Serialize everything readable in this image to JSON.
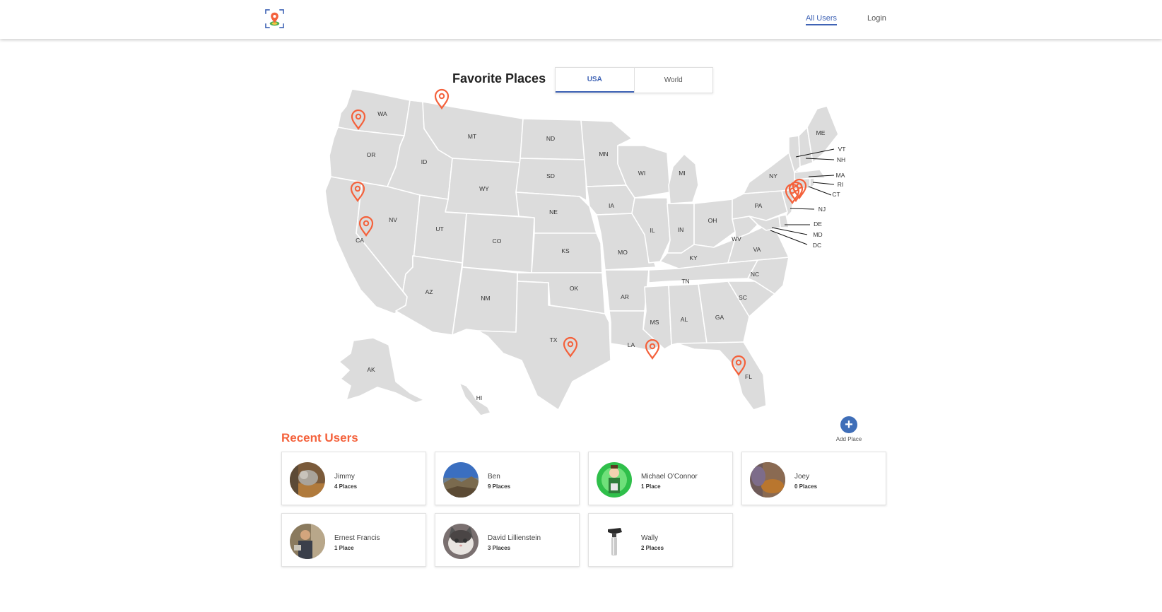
{
  "header": {
    "logo_icon": "map-pin-logo",
    "nav": [
      {
        "label": "All Users",
        "active": true
      },
      {
        "label": "Login",
        "active": false
      }
    ],
    "accent_color": "#3f63b5"
  },
  "main": {
    "title": "Favorite Places",
    "tabs": [
      {
        "label": "USA",
        "active": true
      },
      {
        "label": "World",
        "active": false
      }
    ],
    "map": {
      "region": "USA",
      "pin_color": "#f4613b",
      "state_labels": [
        "WA",
        "OR",
        "CA",
        "ID",
        "NV",
        "MT",
        "WY",
        "UT",
        "AZ",
        "CO",
        "NM",
        "ND",
        "SD",
        "NE",
        "KS",
        "OK",
        "TX",
        "MN",
        "IA",
        "MO",
        "AR",
        "LA",
        "WI",
        "IL",
        "MI",
        "IN",
        "OH",
        "KY",
        "TN",
        "MS",
        "AL",
        "GA",
        "FL",
        "SC",
        "NC",
        "VA",
        "WV",
        "PA",
        "NY",
        "ME",
        "VT",
        "NH",
        "MA",
        "RI",
        "CT",
        "NJ",
        "DE",
        "MD",
        "DC",
        "AK",
        "HI"
      ],
      "pins": [
        "WA",
        "MT",
        "CA",
        "CA",
        "TX",
        "LA",
        "FL",
        "NY",
        "NJ",
        "CT"
      ]
    },
    "add_place": {
      "icon": "plus-icon",
      "label": "Add Place"
    }
  },
  "recent_users": {
    "title": "Recent Users",
    "title_color": "#f4613b",
    "users": [
      {
        "name": "Jimmy",
        "places": "4 Places",
        "avatar": "cat-photo"
      },
      {
        "name": "Ben",
        "places": "9 Places",
        "avatar": "mountain-photo"
      },
      {
        "name": "Michael O'Connor",
        "places": "1 Place",
        "avatar": "cartoon-man"
      },
      {
        "name": "Joey",
        "places": "0 Places",
        "avatar": "blurry-photo"
      },
      {
        "name": "Ernest Francis",
        "places": "1 Place",
        "avatar": "man-photo"
      },
      {
        "name": "David Lillienstein",
        "places": "3 Places",
        "avatar": "kitten-photo"
      },
      {
        "name": "Wally",
        "places": "2 Places",
        "avatar": "tool-photo"
      }
    ]
  }
}
